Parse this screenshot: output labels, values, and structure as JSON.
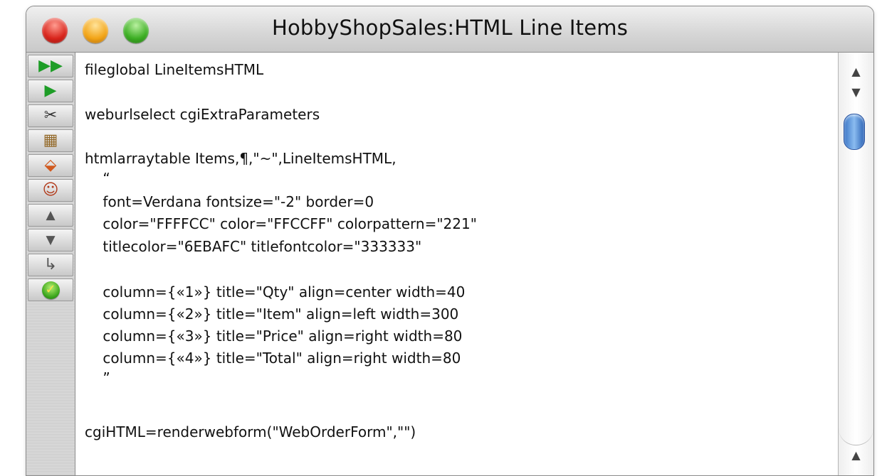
{
  "window": {
    "title": "HobbyShopSales:HTML Line Items"
  },
  "toolbar": {
    "buttons": [
      {
        "name": "run-all-button",
        "icon": "fast-forward-icon",
        "glyph": "▶▶"
      },
      {
        "name": "run-button",
        "icon": "play-icon",
        "glyph": "▶"
      },
      {
        "name": "cut-button",
        "icon": "scissors-icon",
        "glyph": "✂"
      },
      {
        "name": "map-button",
        "icon": "map-icon",
        "glyph": "▦"
      },
      {
        "name": "stamp-button",
        "icon": "stamp-icon",
        "glyph": "⬙"
      },
      {
        "name": "people-button",
        "icon": "people-icon",
        "glyph": "☺"
      },
      {
        "name": "up-button",
        "icon": "triangle-up-icon",
        "glyph": "▲"
      },
      {
        "name": "down-button",
        "icon": "triangle-down-icon",
        "glyph": "▼"
      },
      {
        "name": "step-button",
        "icon": "return-arrow-icon",
        "glyph": "↳"
      },
      {
        "name": "check-button",
        "icon": "checkmark-icon",
        "glyph": "✓"
      }
    ]
  },
  "code": {
    "lines": [
      "fileglobal LineItemsHTML",
      "",
      "weburlselect cgiExtraParameters",
      "",
      "htmlarraytable Items,¶,\"~\",LineItemsHTML,",
      "    “",
      "    font=Verdana fontsize=\"-2\" border=0",
      "    color=\"FFFFCC\" color=\"FFCCFF\" colorpattern=\"221\"",
      "    titlecolor=\"6EBAFC\" titlefontcolor=\"333333\"",
      "",
      "    column={«1»} title=\"Qty\" align=center width=40",
      "    column={«2»} title=\"Item\" align=left width=300",
      "    column={«3»} title=\"Price\" align=right width=80",
      "    column={«4»} title=\"Total\" align=right width=80",
      "    ”",
      "",
      "",
      "cgiHTML=renderwebform(\"WebOrderForm\",\"\")"
    ]
  },
  "scrollbar": {
    "up_glyph": "▲",
    "down_glyph": "▼",
    "bottom_up_glyph": "▲"
  }
}
